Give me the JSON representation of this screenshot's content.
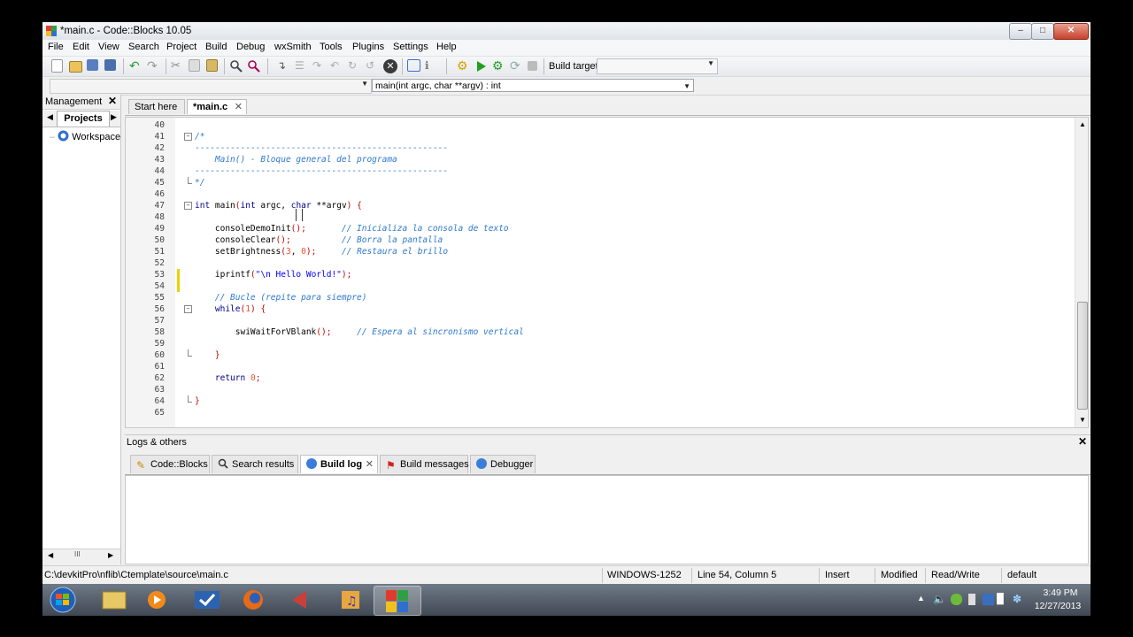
{
  "window": {
    "title": "*main.c - Code::Blocks 10.05"
  },
  "menu": [
    "File",
    "Edit",
    "View",
    "Search",
    "Project",
    "Build",
    "Debug",
    "wxSmith",
    "Tools",
    "Plugins",
    "Settings",
    "Help"
  ],
  "toolbar": {
    "build_target_label": "Build target:",
    "build_target_value": ""
  },
  "code_completion": {
    "scope": "",
    "function": "main(int argc, char **argv) : int"
  },
  "management": {
    "title": "Management",
    "tab": "Projects",
    "workspace": "Workspace",
    "scroll_glyph": "III"
  },
  "editor": {
    "tabs": [
      {
        "label": "Start here",
        "active": false
      },
      {
        "label": "*main.c",
        "active": true
      }
    ],
    "lines": [
      {
        "n": "40",
        "html": ""
      },
      {
        "n": "41",
        "html": "<span class='cmt'>/*</span>",
        "fold": "minus"
      },
      {
        "n": "42",
        "html": "<span class='dash'>--------------------------------------------------</span>"
      },
      {
        "n": "43",
        "html": "<span class='cmt'>    Main() - Bloque general del programa</span>"
      },
      {
        "n": "44",
        "html": "<span class='dash'>--------------------------------------------------</span>"
      },
      {
        "n": "45",
        "html": "<span class='cmt'>*/</span>",
        "fold": "end"
      },
      {
        "n": "46",
        "html": ""
      },
      {
        "n": "47",
        "html": "<span class='kw'>int</span> main<span class='punc'>(</span><span class='kw'>int</span> argc, <span class='kw'>char</span> **argv<span class='punc'>)</span> <span class='punc'>{</span>",
        "fold": "minus"
      },
      {
        "n": "48",
        "html": ""
      },
      {
        "n": "49",
        "html": "    consoleDemoInit<span class='punc'>();</span>       <span class='cmt'>// Inicializa la consola de texto</span>"
      },
      {
        "n": "50",
        "html": "    consoleClear<span class='punc'>();</span>          <span class='cmt'>// Borra la pantalla</span>"
      },
      {
        "n": "51",
        "html": "    setBrightness<span class='punc'>(</span><span class='num'>3</span>, <span class='num'>0</span><span class='punc'>);</span>     <span class='cmt'>// Restaura el brillo</span>"
      },
      {
        "n": "52",
        "html": ""
      },
      {
        "n": "53",
        "html": "    iprintf<span class='punc'>(</span><span class='str'>\"\\n Hello World!\"</span><span class='punc'>);</span>",
        "changed": true
      },
      {
        "n": "54",
        "html": "",
        "changed": true
      },
      {
        "n": "55",
        "html": "    <span class='cmt'>// Bucle (repite para siempre)</span>"
      },
      {
        "n": "56",
        "html": "    <span class='kw'>while</span><span class='punc'>(</span><span class='num'>1</span><span class='punc'>)</span> <span class='punc'>{</span>",
        "fold": "minus"
      },
      {
        "n": "57",
        "html": ""
      },
      {
        "n": "58",
        "html": "        swiWaitForVBlank<span class='punc'>();</span>     <span class='cmt'>// Espera al sincronismo vertical</span>"
      },
      {
        "n": "59",
        "html": ""
      },
      {
        "n": "60",
        "html": "    <span class='punc'>}</span>",
        "fold": "end"
      },
      {
        "n": "61",
        "html": ""
      },
      {
        "n": "62",
        "html": "    <span class='kw'>return</span> <span class='num'>0</span><span class='punc'>;</span>"
      },
      {
        "n": "63",
        "html": ""
      },
      {
        "n": "64",
        "html": "<span class='punc'>}</span>",
        "fold": "end"
      },
      {
        "n": "65",
        "html": ""
      }
    ]
  },
  "logs": {
    "title": "Logs & others",
    "tabs": [
      {
        "label": "Code::Blocks",
        "icon": "pencil-icon",
        "active": false
      },
      {
        "label": "Search results",
        "icon": "magnifier-icon",
        "active": false
      },
      {
        "label": "Build log",
        "icon": "gear-icon",
        "active": true
      },
      {
        "label": "Build messages",
        "icon": "pin-icon",
        "active": false
      },
      {
        "label": "Debugger",
        "icon": "gear-icon",
        "active": false
      }
    ]
  },
  "status": {
    "path": "C:\\devkitPro\\nflib\\Ctemplate\\source\\main.c",
    "encoding": "WINDOWS-1252",
    "position": "Line 54, Column 5",
    "mode": "Insert",
    "modified": "Modified",
    "access": "Read/Write",
    "profile": "default"
  },
  "taskbar": {
    "time": "3:49 PM",
    "date": "12/27/2013"
  },
  "colors": {
    "comment": "#2c79cf",
    "keyword": "#00008b",
    "string": "#0000ff",
    "number": "#f05030",
    "changed_marker": "#e8d300"
  }
}
